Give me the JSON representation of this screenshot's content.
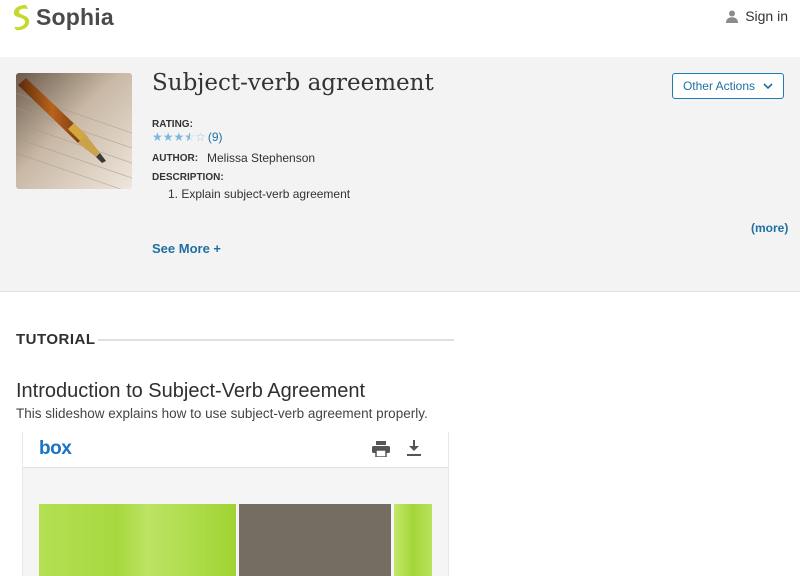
{
  "header": {
    "brand": "Sophia",
    "signin_label": "Sign in"
  },
  "resource": {
    "title": "Subject-verb agreement",
    "actions_label": "Other Actions",
    "rating_label": "RATING:",
    "rating_value": 3.5,
    "rating_max": 5,
    "rating_count": "(9)",
    "author_label": "AUTHOR:",
    "author_name": "Melissa Stephenson",
    "description_label": "DESCRIPTION:",
    "description_item": "1. Explain subject-verb agreement",
    "more_label": "(more)",
    "see_more_label": "See More +"
  },
  "tutorial": {
    "section_heading": "TUTORIAL",
    "title": "Introduction to Subject-Verb Agreement",
    "description": "This slideshow explains how to use subject-verb agreement properly."
  },
  "viewer": {
    "brand": "box",
    "icons": [
      "print-icon",
      "download-icon"
    ]
  },
  "colors": {
    "link": "#1f6fa3",
    "brand_green": "#c6d92b",
    "star": "#7ab8de",
    "band_bg": "#f3f3f3"
  }
}
